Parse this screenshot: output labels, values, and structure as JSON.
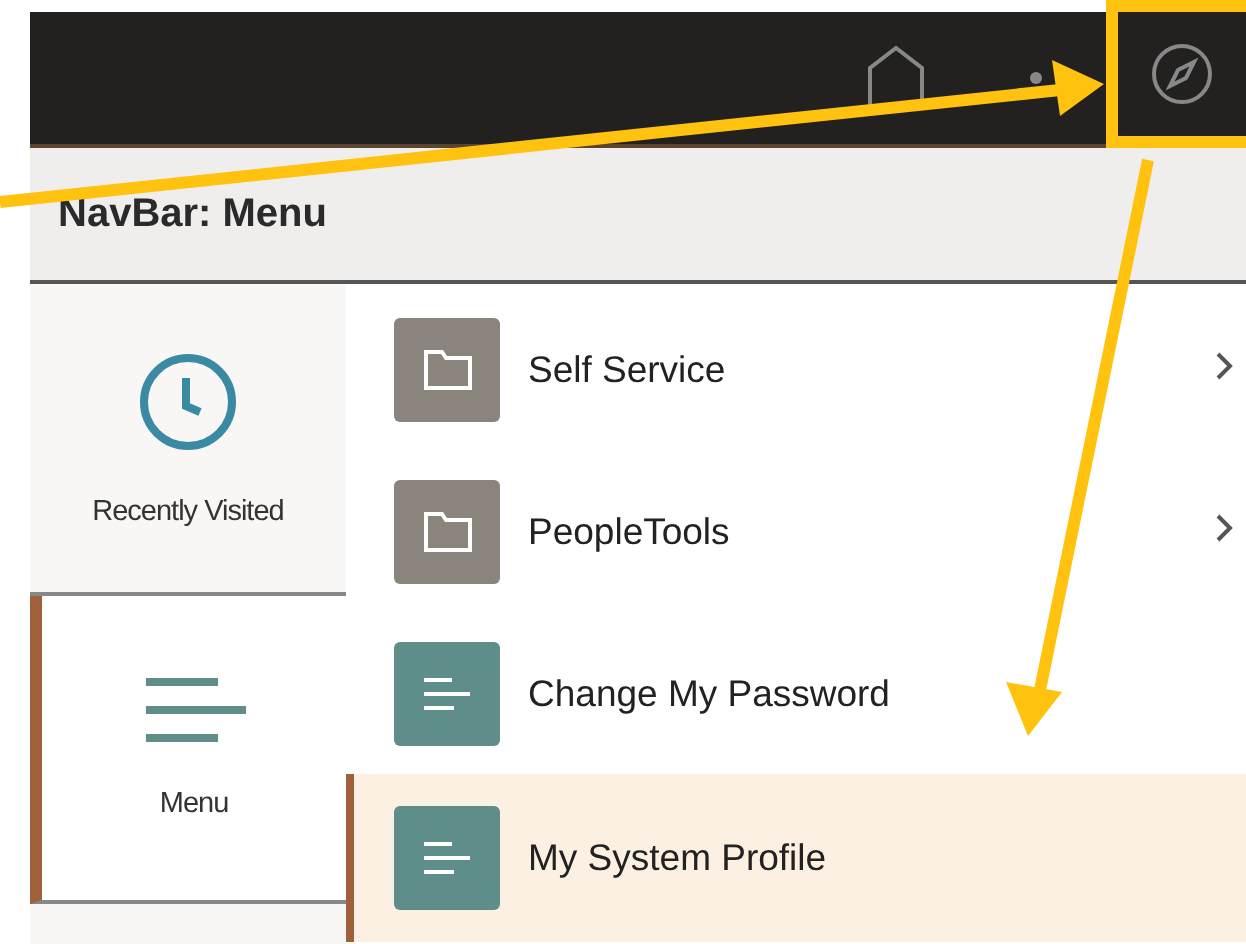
{
  "navbar": {
    "items": [
      {
        "kind": "home",
        "highlighted": false
      },
      {
        "kind": "more",
        "highlighted": false
      },
      {
        "kind": "navigator",
        "highlighted": true
      }
    ]
  },
  "header": {
    "title": "NavBar: Menu"
  },
  "sidebar": {
    "items": [
      {
        "label": "Recently Visited",
        "kind": "recent",
        "selected": false
      },
      {
        "label": "Menu",
        "kind": "menu",
        "selected": true
      }
    ]
  },
  "menu": {
    "items": [
      {
        "label": "Self Service",
        "kind": "folder",
        "selected": false
      },
      {
        "label": "PeopleTools",
        "kind": "folder",
        "selected": false
      },
      {
        "label": "Change My Password",
        "kind": "page",
        "selected": false
      },
      {
        "label": "My System Profile",
        "kind": "page",
        "selected": true
      }
    ]
  }
}
